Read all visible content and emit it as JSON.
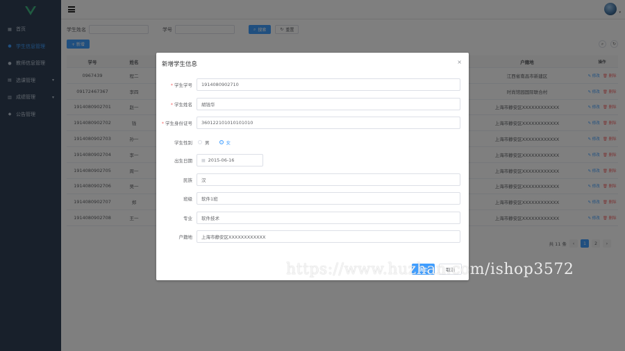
{
  "sidebar": {
    "items": [
      {
        "label": "首页",
        "icon": "dashboard-icon",
        "active": false,
        "has_children": false
      },
      {
        "label": "学生信息管理",
        "icon": "user-icon",
        "active": true,
        "has_children": false
      },
      {
        "label": "教师信息管理",
        "icon": "user-icon",
        "active": false,
        "has_children": false
      },
      {
        "label": "选课管理",
        "icon": "book-icon",
        "active": false,
        "has_children": true
      },
      {
        "label": "成绩管理",
        "icon": "chart-icon",
        "active": false,
        "has_children": true
      },
      {
        "label": "公告管理",
        "icon": "message-icon",
        "active": false,
        "has_children": false
      }
    ]
  },
  "search": {
    "name_label": "学生姓名",
    "id_label": "学号",
    "search_btn": "搜索",
    "reset_btn": "重置"
  },
  "toolbar": {
    "add_label": "+ 新增"
  },
  "table": {
    "headers": {
      "id": "学号",
      "name": "姓名",
      "mid": "",
      "addr": "户籍地",
      "op": "操作"
    },
    "edit_label": "修改",
    "delete_label": "删除",
    "rows": [
      {
        "id": "0967439",
        "name": "程二",
        "addr": "江西省南昌市新建区"
      },
      {
        "id": "09172467367",
        "name": "李四",
        "addr": "时尚馆园国际联合村"
      },
      {
        "id": "1914080902701",
        "name": "赵一",
        "addr": "上海市静安区XXXXXXXXXXXX"
      },
      {
        "id": "1914080902702",
        "name": "钱",
        "addr": "上海市静安区XXXXXXXXXXXX"
      },
      {
        "id": "1914080902703",
        "name": "孙一",
        "addr": "上海市静安区XXXXXXXXXXXX"
      },
      {
        "id": "1914080902704",
        "name": "李一",
        "addr": "上海市静安区XXXXXXXXXXXX"
      },
      {
        "id": "1914080902705",
        "name": "周一",
        "addr": "上海市静安区XXXXXXXXXXXX"
      },
      {
        "id": "1914080902706",
        "name": "吴一",
        "addr": "上海市静安区XXXXXXXXXXXX"
      },
      {
        "id": "1914080902707",
        "name": "郑",
        "addr": "上海市静安区XXXXXXXXXXXX"
      },
      {
        "id": "1914080902708",
        "name": "王一",
        "addr": "上海市静安区XXXXXXXXXXXX"
      }
    ]
  },
  "pager": {
    "total": "共 11 条",
    "prev": "‹",
    "next": "›",
    "pages": [
      "1",
      "2"
    ],
    "current": "1"
  },
  "dialog": {
    "title": "新增学生信息",
    "close": "×",
    "fields": {
      "student_id": {
        "label": "学生学号",
        "value": "1914080902710",
        "required": true
      },
      "student_name": {
        "label": "学生姓名",
        "value": "胡钱华",
        "required": true
      },
      "id_card": {
        "label": "学生身份证号",
        "value": "360122101010101010",
        "required": true
      },
      "gender": {
        "label": "学生性别",
        "options": [
          "男",
          "女"
        ],
        "selected": "女"
      },
      "birth": {
        "label": "出生日期",
        "value": "2015-06-16"
      },
      "ethnicity": {
        "label": "民族",
        "value": "汉"
      },
      "class": {
        "label": "班级",
        "value": "软件1班"
      },
      "major": {
        "label": "专业",
        "value": "软件技术"
      },
      "hukou": {
        "label": "户籍地",
        "value": "上海市静安区XXXXXXXXXXXX"
      }
    },
    "confirm": "确定",
    "cancel": "取消"
  },
  "watermark": "https://www.huzhan.com/ishop3572",
  "colors": {
    "primary": "#409eff",
    "danger": "#f56c6c",
    "sidebar": "#304156",
    "logo": "#41b883"
  }
}
